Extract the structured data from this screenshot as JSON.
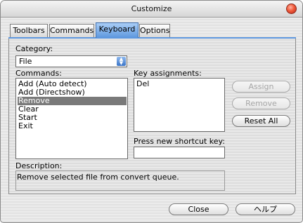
{
  "window": {
    "title": "Customize"
  },
  "tabs": [
    {
      "label": "Toolbars"
    },
    {
      "label": "Commands"
    },
    {
      "label": "Keyboard"
    },
    {
      "label": "Options"
    }
  ],
  "category": {
    "label": "Category:",
    "value": "File"
  },
  "commands": {
    "label": "Commands:",
    "items": [
      "Add (Auto detect)",
      "Add (Directshow)",
      "Remove",
      "Clear",
      "Start",
      "Exit"
    ],
    "selected": "Remove"
  },
  "key_assignments": {
    "label": "Key assignments:",
    "items": [
      "Del"
    ]
  },
  "shortcut": {
    "label": "Press new shortcut key:",
    "value": ""
  },
  "buttons": {
    "assign": "Assign",
    "remove": "Remove",
    "reset_all": "Reset All",
    "close": "Close",
    "help": "ヘルプ"
  },
  "description": {
    "label": "Description:",
    "text": "Remove selected file from convert queue."
  },
  "colors": {
    "active_tab": "#5d97de",
    "selection": "#7a7a7a",
    "close_button": "#f05a3a"
  }
}
